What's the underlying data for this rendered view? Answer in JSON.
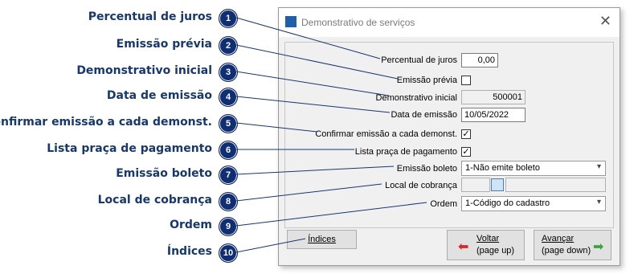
{
  "callouts": [
    {
      "num": "1",
      "label": "Percentual de juros"
    },
    {
      "num": "2",
      "label": "Emissão prévia"
    },
    {
      "num": "3",
      "label": "Demonstrativo inicial"
    },
    {
      "num": "4",
      "label": "Data de emissão"
    },
    {
      "num": "5",
      "label": "Confirmar emissão a cada demonst."
    },
    {
      "num": "6",
      "label": "Lista praça de pagamento"
    },
    {
      "num": "7",
      "label": "Emissão boleto"
    },
    {
      "num": "8",
      "label": "Local de cobrança"
    },
    {
      "num": "9",
      "label": "Ordem"
    },
    {
      "num": "10",
      "label": "Índices"
    }
  ],
  "dialog": {
    "title": "Demonstrativo de serviços",
    "close": "✕",
    "fields": {
      "percentual_label": "Percentual de juros",
      "percentual_value": "0,00",
      "emissao_previa_label": "Emissão prévia",
      "demonstrativo_label": "Demonstrativo inicial",
      "demonstrativo_value": "500001",
      "data_label": "Data de emissão",
      "data_value": "10/05/2022",
      "confirmar_label": "Confirmar emissão a cada demonst.",
      "confirmar_check": "✓",
      "lista_label": "Lista praça de pagamento",
      "lista_check": "✓",
      "boleto_label": "Emissão boleto",
      "boleto_value": "1-Não emite boleto",
      "local_label": "Local de cobrança",
      "local_value": "",
      "ordem_label": "Ordem",
      "ordem_value": "1-Código do cadastro"
    },
    "buttons": {
      "indices": "Índices",
      "voltar_1": "Voltar",
      "voltar_2": "(page up)",
      "avancar_1": "Avançar",
      "avancar_2": "(page down)"
    },
    "colors": {
      "accent": "#0f2e73",
      "voltar_arrow": "#d62828",
      "avancar_arrow": "#3aa53a"
    }
  }
}
